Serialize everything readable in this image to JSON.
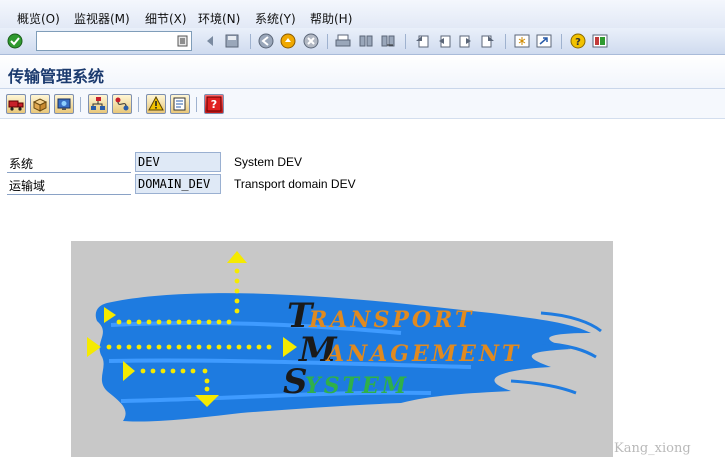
{
  "menu": {
    "items": [
      "概览(O)",
      "监视器(M)",
      "细节(X)",
      "环境(N)",
      "系统(Y)",
      "帮助(H)"
    ]
  },
  "toolbar": {
    "command_value": "",
    "icons": [
      "enter-check-icon",
      "command-dropdown-icon",
      "back-arrow-icon",
      "save-icon",
      "back-icon",
      "exit-icon",
      "cancel-icon",
      "print-icon",
      "find-icon",
      "find-next-icon",
      "first-page-icon",
      "previous-page-icon",
      "next-page-icon",
      "last-page-icon",
      "new-session-icon",
      "shortcut-icon",
      "help-icon",
      "layout-icon"
    ]
  },
  "page": {
    "title": "传输管理系统"
  },
  "form": {
    "rows": [
      {
        "label": "系统",
        "value": "DEV",
        "description": "System DEV"
      },
      {
        "label": "运输域",
        "value": "DOMAIN_DEV",
        "description": "Transport domain DEV"
      }
    ]
  },
  "logo": {
    "line1": "TRANSPORT",
    "line2": "MANAGEMENT",
    "line3": "SYSTEM",
    "colors": {
      "background": "#c8c8c8",
      "splash": "#1e7be0",
      "arrow": "#f5ea00"
    }
  },
  "watermark": "Kang_xiong"
}
